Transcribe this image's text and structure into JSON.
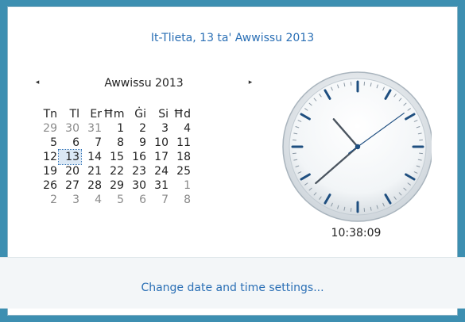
{
  "header": {
    "date_text": "It-Tlieta, 13 ta' Awwissu 2013"
  },
  "calendar": {
    "month_label": "Awwissu 2013",
    "prev_icon": "◂",
    "next_icon": "▸",
    "weekdays": [
      "Tn",
      "Tl",
      "Er",
      "Ħm",
      "Ġi",
      "Si",
      "Ħd"
    ],
    "weeks": [
      [
        "29",
        "30",
        "31",
        "1",
        "2",
        "3",
        "4"
      ],
      [
        "5",
        "6",
        "7",
        "8",
        "9",
        "10",
        "11"
      ],
      [
        "12",
        "13",
        "14",
        "15",
        "16",
        "17",
        "18"
      ],
      [
        "19",
        "20",
        "21",
        "22",
        "23",
        "24",
        "25"
      ],
      [
        "26",
        "27",
        "28",
        "29",
        "30",
        "31",
        "1"
      ],
      [
        "2",
        "3",
        "4",
        "5",
        "6",
        "7",
        "8"
      ]
    ],
    "selected_day": "13"
  },
  "clock": {
    "time_text": "10:38:09",
    "hour": 10,
    "minute": 38,
    "second": 9
  },
  "footer": {
    "settings_link": "Change date and time settings..."
  },
  "colors": {
    "accent": "#2a6fb5",
    "background": "#3d8fb1",
    "other_month": "#8a8a8a"
  }
}
